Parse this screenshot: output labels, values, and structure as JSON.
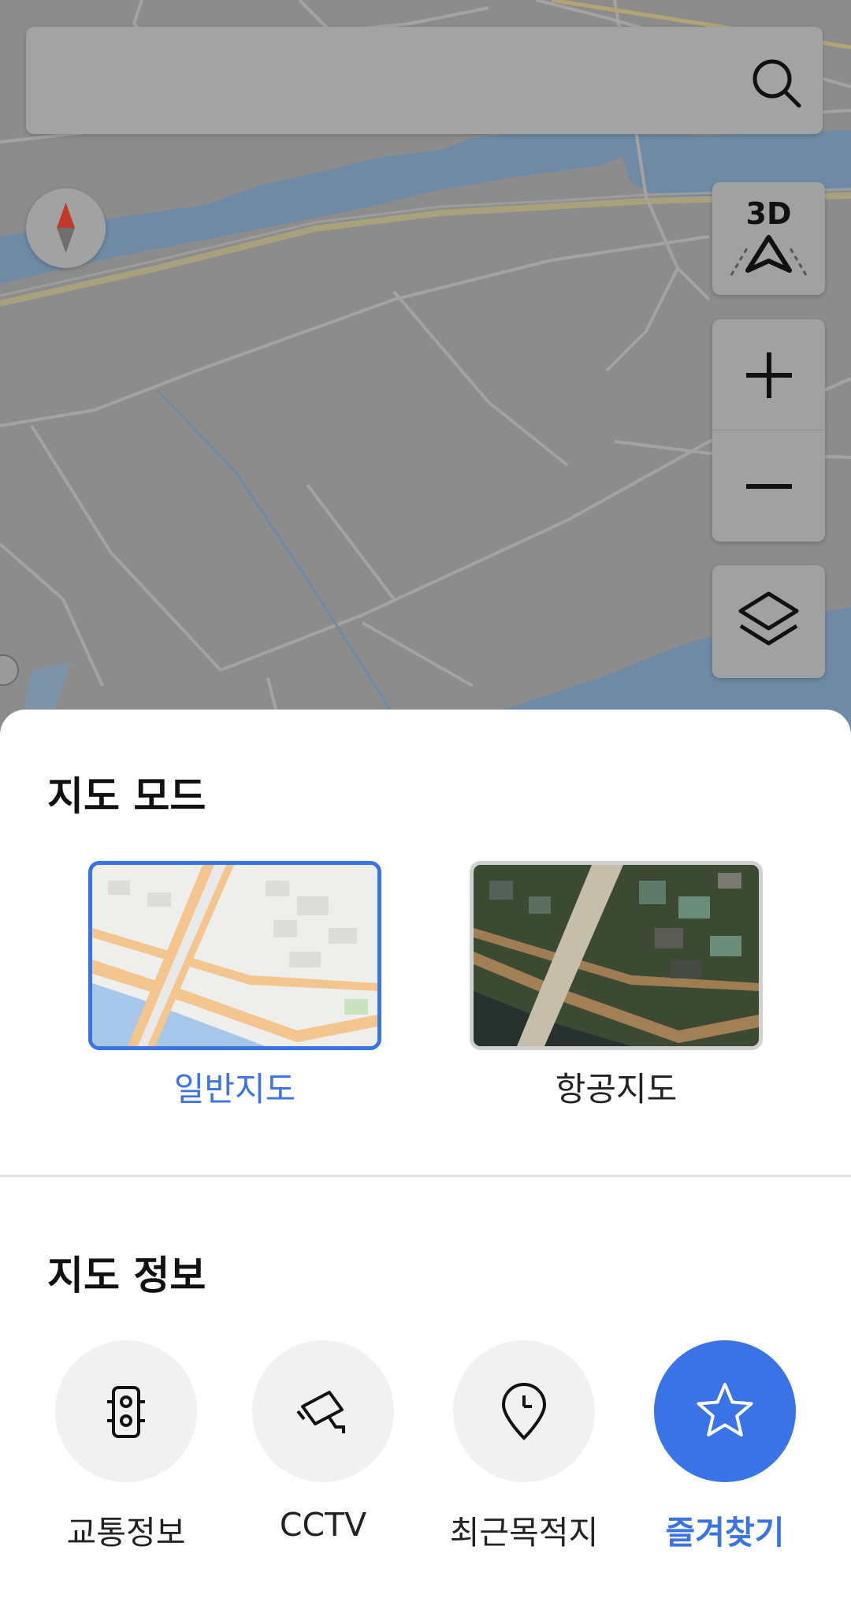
{
  "search": {
    "placeholder": "",
    "value": ""
  },
  "map_controls": {
    "three_d_label": "3D",
    "zoom_in": "zoom-in",
    "zoom_out": "zoom-out",
    "layers": "layers"
  },
  "map_mode": {
    "title": "지도 모드",
    "options": [
      {
        "label": "일반지도",
        "selected": true
      },
      {
        "label": "항공지도",
        "selected": false
      }
    ]
  },
  "map_info": {
    "title": "지도 정보",
    "items": [
      {
        "label": "교통정보",
        "icon": "traffic-light-icon",
        "active": false
      },
      {
        "label": "CCTV",
        "icon": "cctv-camera-icon",
        "active": false
      },
      {
        "label": "최근목적지",
        "icon": "recent-location-pin-icon",
        "active": false
      },
      {
        "label": "즐겨찾기",
        "icon": "star-icon",
        "active": true
      }
    ]
  },
  "colors": {
    "accent": "#3a73e6",
    "map_dim": "#8c8c8c",
    "water": "#6e8aa4"
  }
}
